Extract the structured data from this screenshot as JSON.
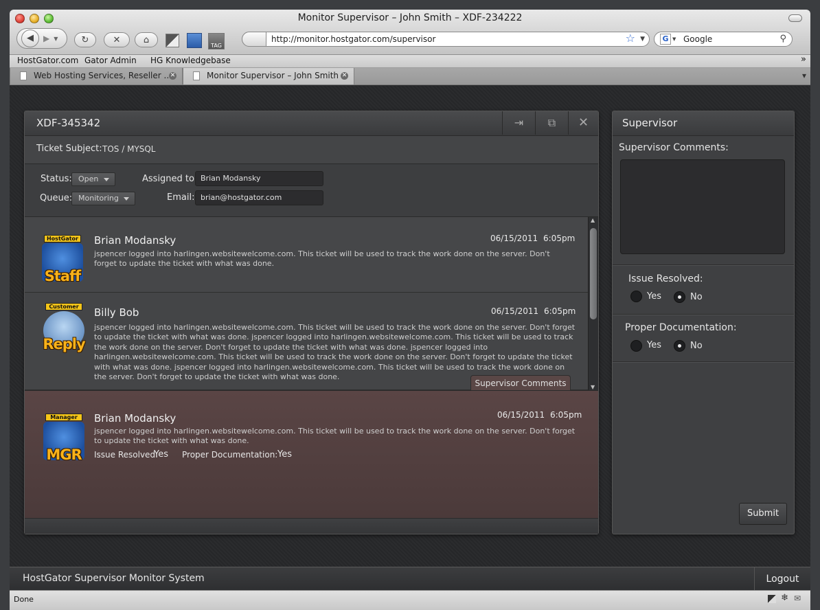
{
  "window": {
    "title": "Monitor Supervisor – John Smith – XDF-234222"
  },
  "toolbar": {
    "url": "http://monitor.hostgator.com/supervisor",
    "search_placeholder": "Google",
    "tag_label": "TAG"
  },
  "bookmarks": [
    "HostGator.com",
    "Gator Admin",
    "HG Knowledgebase"
  ],
  "tabs": [
    {
      "label": "Web Hosting Services, Reseller ..."
    },
    {
      "label": "Monitor Supervisor – John Smith"
    }
  ],
  "ticket": {
    "id": "XDF-345342",
    "subject_label": "Ticket Subject:",
    "subject": "TOS / MYSQL",
    "status_label": "Status:",
    "status": "Open",
    "queue_label": "Queue:",
    "queue": "Monitoring",
    "assigned_label": "Assigned to:",
    "assigned": "Brian Modansky",
    "email_label": "Email:",
    "email": "brian@hostgator.com"
  },
  "messages": [
    {
      "badge": "HostGator",
      "badge_word": "Staff",
      "name": "Brian Modansky",
      "date": "06/15/2011",
      "time": "6:05pm",
      "body": "jspencer logged into harlingen.websitewelcome.com. This ticket will be used to track the work done on the server. Don't forget to update the ticket with what was done."
    },
    {
      "badge": "Customer",
      "badge_word": "Reply",
      "name": "Billy Bob",
      "date": "06/15/2011",
      "time": "6:05pm",
      "body": "jspencer logged into harlingen.websitewelcome.com. This ticket will be used to track the work done on the server. Don't forget to update the ticket with what was done. jspencer logged into harlingen.websitewelcome.com. This ticket will be used to track the work done on the server. Don't forget to update the ticket with what was done. jspencer logged into harlingen.websitewelcome.com. This ticket will be used to track the work done on the server. Don't forget to update the ticket with what was done. jspencer logged into harlingen.websitewelcome.com. This ticket will be used to track the work done on the server. Don't forget to update the ticket with what was done."
    }
  ],
  "supervisor_tab": "Supervisor Comments",
  "supervisor_message": {
    "badge": "Manager",
    "badge_word": "MGR",
    "name": "Brian Modansky",
    "date": "06/15/2011",
    "time": "6:05pm",
    "body": "jspencer logged into harlingen.websitewelcome.com. This ticket will be used to track the work done on the server. Don't forget to update the ticket with what was done.",
    "issue_label": "Issue Resolved:",
    "issue_value": "Yes",
    "doc_label": "Proper Documentation:",
    "doc_value": "Yes"
  },
  "supervisor": {
    "title": "Supervisor",
    "comments_label": "Supervisor Comments:",
    "issue_label": "Issue Resolved:",
    "doc_label": "Proper Documentation:",
    "yes": "Yes",
    "no": "No",
    "issue_selected": "No",
    "doc_selected": "No",
    "submit": "Submit"
  },
  "footer": {
    "system_name": "HostGator Supervisor Monitor System",
    "logout": "Logout"
  },
  "status_bar": {
    "text": "Done"
  }
}
